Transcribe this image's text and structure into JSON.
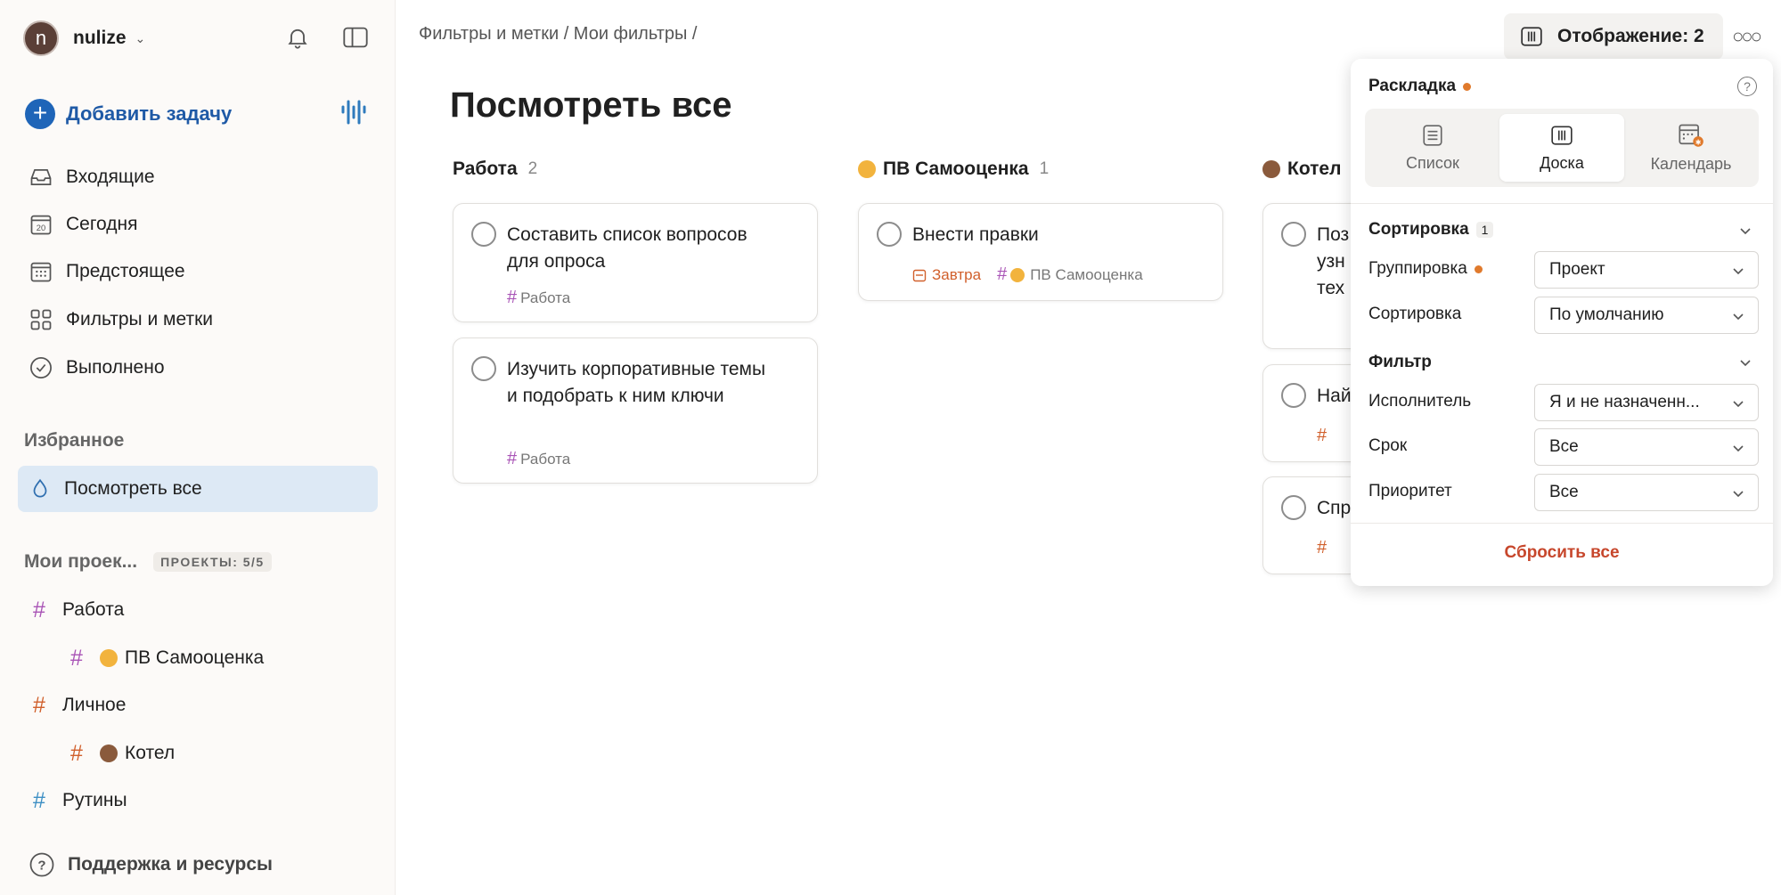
{
  "user": {
    "initial": "n",
    "name": "nulize"
  },
  "sidebar": {
    "add_task": "Добавить задачу",
    "nav": [
      {
        "label": "Входящие",
        "icon": "inbox-icon"
      },
      {
        "label": "Сегодня",
        "icon": "calendar-today-icon",
        "day": "20"
      },
      {
        "label": "Предстоящее",
        "icon": "calendar-upcoming-icon"
      },
      {
        "label": "Фильтры и метки",
        "icon": "filters-grid-icon"
      },
      {
        "label": "Выполнено",
        "icon": "check-circle-icon"
      }
    ],
    "favorites_title": "Избранное",
    "favorite": {
      "label": "Посмотреть все",
      "icon": "drop-icon"
    },
    "projects_title": "Мои проек...",
    "projects_badge": "ПРОЕКТЫ: 5/5",
    "projects": [
      {
        "label": "Работа",
        "color": "#a954b6"
      },
      {
        "label": "ПВ Самооценка",
        "color": "#a954b6",
        "emoji_color": "#f2b33d"
      },
      {
        "label": "Личное",
        "color": "#d1602c"
      },
      {
        "label": "Котел",
        "color": "#d1602c",
        "emoji_color": "#8a5a3c"
      },
      {
        "label": "Рутины",
        "color": "#3d8fc4"
      }
    ],
    "support": "Поддержка и ресурсы"
  },
  "header": {
    "breadcrumb": "Фильтры и метки / Мои фильтры /",
    "view_button": "Отображение: 2"
  },
  "page_title": "Посмотреть все",
  "columns": [
    {
      "title": "Работа",
      "count": "2",
      "cards": [
        {
          "text": "Составить список вопросов для опроса",
          "tag": "Работа"
        },
        {
          "text": "Изучить корпоративные темы и подобрать к ним ключи",
          "tag": "Работа"
        }
      ]
    },
    {
      "title": "ПВ Самооценка",
      "count": "1",
      "cards": [
        {
          "text": "Внести правки",
          "date": "Завтра",
          "tag": "ПВ Самооценка"
        }
      ]
    },
    {
      "title": "Котел",
      "cards": [
        {
          "text": "Поз узн тех"
        },
        {
          "text": "Най"
        },
        {
          "text": "Спр"
        }
      ]
    }
  ],
  "popup": {
    "layout_title": "Раскладка",
    "layouts": [
      "Список",
      "Доска",
      "Календарь"
    ],
    "sorting_title": "Сортировка",
    "sorting_count": "1",
    "grouping_label": "Группировка",
    "grouping_value": "Проект",
    "sort_label": "Сортировка",
    "sort_value": "По умолчанию",
    "filter_title": "Фильтр",
    "assignee_label": "Исполнитель",
    "assignee_value": "Я и не назначенн...",
    "due_label": "Срок",
    "due_value": "Все",
    "priority_label": "Приоритет",
    "priority_value": "Все",
    "reset": "Сбросить все"
  }
}
